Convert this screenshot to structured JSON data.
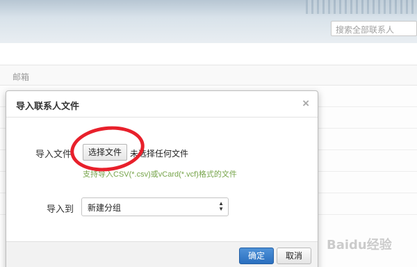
{
  "header": {
    "search_placeholder": "搜索全部联系人"
  },
  "list": {
    "column_email": "邮箱"
  },
  "dialog": {
    "title": "导入联系人文件",
    "close_glyph": "×",
    "file_label": "导入文件",
    "choose_button": "选择文件",
    "no_file_text": "未选择任何文件",
    "hint_text": "支持导入CSV(*.csv)或vCard(*.vcf)格式的文件",
    "group_label": "导入到",
    "group_selected": "新建分组",
    "ok_button": "确定",
    "cancel_button": "取消"
  },
  "watermark": "Baidu经验",
  "colors": {
    "accent": "#2a6fbf",
    "hint": "#76a44a",
    "annotation": "#e8202b"
  }
}
